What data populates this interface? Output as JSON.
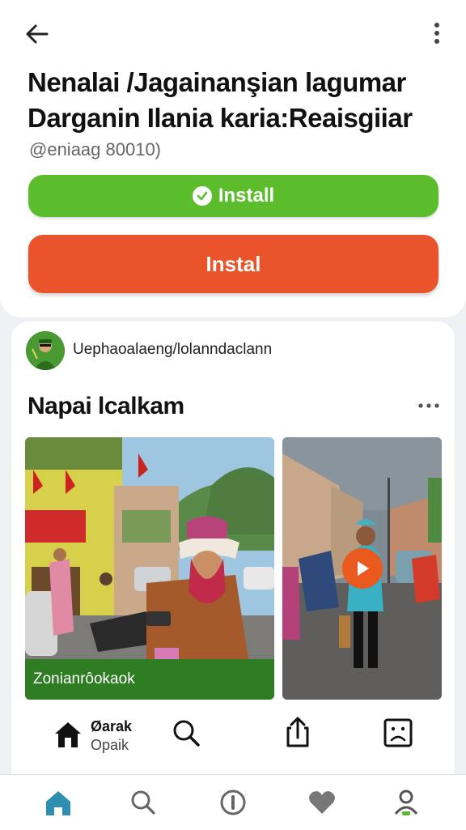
{
  "header": {
    "back_icon": "arrow-left-icon",
    "more_icon": "more-vertical-icon",
    "title_line1": "Nenalai /Jagainanşian lagumar",
    "title_line2": "Darganin Ilania karia:Reaisgiiar",
    "subtitle": "@eniaag 80010)"
  },
  "buttons": {
    "install_label": "Install",
    "instal_label": "Instal",
    "green_color": "#5bbd2c",
    "orange_color": "#e9542a"
  },
  "post": {
    "username": "Uephaoalaeng/lolanndaclann",
    "title": "Napai lcalkam",
    "media_caption": "Zonianrôokaok",
    "play_icon": "play-icon"
  },
  "actions": {
    "home_label_1": "Øarak",
    "home_label_2": "Opaik",
    "home_icon": "home-icon",
    "search_icon": "search-icon",
    "share_icon": "share-icon",
    "sad_icon": "sad-face-icon"
  },
  "bottom_nav": {
    "items": [
      "home-icon",
      "search-icon",
      "compass-icon",
      "heart-icon",
      "profile-icon"
    ],
    "accent": "#2e8fb0"
  }
}
